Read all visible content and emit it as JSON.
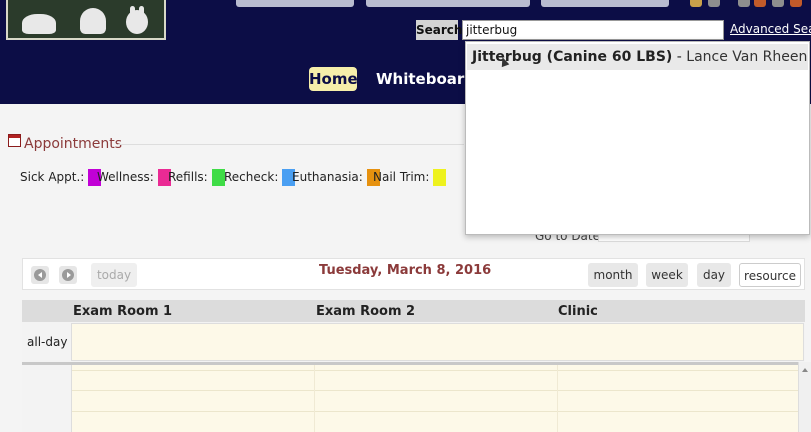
{
  "header": {
    "search_label": "Search",
    "search_value": "jitterbug",
    "advanced_search": "Advanced Search",
    "nav": {
      "home": "Home",
      "whiteboard": "Whiteboard"
    }
  },
  "autocomplete": {
    "results": [
      {
        "patient": "Jitterbug (Canine 60 LBS)",
        "separator": " - ",
        "owner": "Lance Van Rheenen"
      }
    ]
  },
  "appointments": {
    "title": "Appointments",
    "legend": [
      {
        "label": "Sick Appt.:",
        "color": "#c100d6"
      },
      {
        "label": "Wellness:",
        "color": "#ea2a94"
      },
      {
        "label": "Refills:",
        "color": "#3fdc46"
      },
      {
        "label": "Recheck:",
        "color": "#4a9ff2"
      },
      {
        "label": "Euthanasia:",
        "color": "#e6910f"
      },
      {
        "label": "Nail Trim:",
        "color": "#eef21e"
      }
    ],
    "goto_label": "Go to Date:"
  },
  "calendar": {
    "today_label": "today",
    "date": "Tuesday, March 8, 2016",
    "views": {
      "month": "month",
      "week": "week",
      "day": "day",
      "resource": "resource"
    },
    "columns": [
      "Exam Room 1",
      "Exam Room 2",
      "Clinic"
    ],
    "all_day_label": "all-day"
  },
  "colors": {
    "header_bg": "#0c0d46",
    "accent_title": "#8b3a3a",
    "home_highlight": "#f6eeaa",
    "allday_bg": "#fdf9e8"
  }
}
